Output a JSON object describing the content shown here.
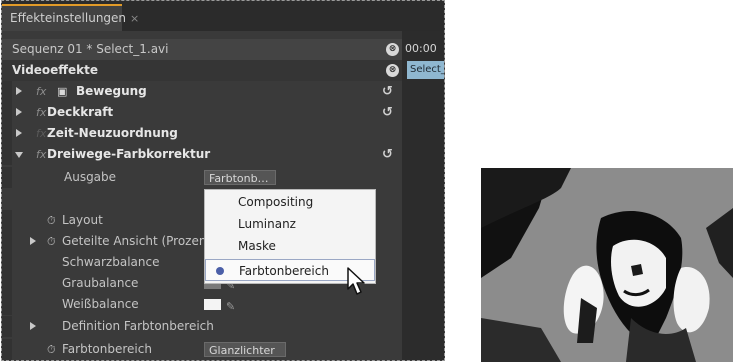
{
  "panel": {
    "tab_label": "Effekteinstellungen",
    "tab_close": "×",
    "sequence_label": "Sequenz 01 * Select_1.avi",
    "video_effects_label": "Videoeffekte",
    "effects": [
      {
        "label": "Bewegung",
        "expanded": false
      },
      {
        "label": "Deckkraft",
        "expanded": false
      },
      {
        "label": "Zeit-Neuzuordnung",
        "expanded": false
      },
      {
        "label": "Dreiwege-Farbkorrektur",
        "expanded": true
      }
    ],
    "fx_label": "fx",
    "properties": {
      "ausgabe_label": "Ausgabe",
      "ausgabe_value": "Farbtonb…",
      "layout_label": "Layout",
      "split_label": "Geteilte Ansicht (Prozent)",
      "black_label": "Schwarzbalance",
      "gray_label": "Graubalance",
      "white_label": "Weißbalance",
      "def_label": "Definition Farbtonbereich",
      "range_label": "Farbtonbereich",
      "range_value": "Glanzlichter"
    }
  },
  "menu": {
    "items": [
      "Compositing",
      "Luminanz",
      "Maske",
      "Farbtonbereich"
    ],
    "selected_index": 3
  },
  "timeline": {
    "time": "00:00",
    "clip_label": "Select_"
  },
  "colors": {
    "panel_bg": "#3a3a3a",
    "tab_accent": "#e19a28",
    "clip": "#8fb7d0",
    "menu_selected_dot": "#4b5fa8"
  }
}
